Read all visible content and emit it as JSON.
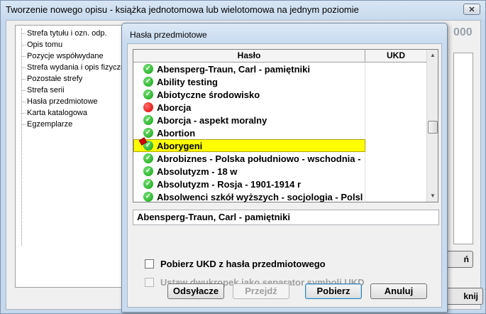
{
  "outer_window": {
    "title": "Tworzenie nowego opisu - książka jednotomowa lub wielotomowa na jednym poziomie",
    "close_glyph": "✕",
    "nav_items": [
      "Strefa tytułu i ozn. odp.",
      "Opis tomu",
      "Pozycje współwydane",
      "Strefa wydania i opis fizyczny",
      "Pozostałe strefy",
      "Strefa serii",
      "Hasła przedmiotowe",
      "Karta katalogowa",
      "Egzemplarze"
    ],
    "background_counter": "000",
    "background_button_1": "ń",
    "background_button_2": "knij"
  },
  "dialog": {
    "title": "Hasła przedmiotowe",
    "grid": {
      "headers": {
        "haslo": "Hasło",
        "ukd": "UKD"
      },
      "rows": [
        {
          "label": "Abensperg-Traun, Carl - pamiętniki",
          "status": "ok",
          "ukd": ""
        },
        {
          "label": "Ability testing",
          "status": "ok",
          "ukd": ""
        },
        {
          "label": "Abiotyczne środowisko",
          "status": "ok",
          "ukd": ""
        },
        {
          "label": "Aborcja",
          "status": "error",
          "ukd": ""
        },
        {
          "label": "Aborcja - aspekt moralny",
          "status": "ok",
          "ukd": ""
        },
        {
          "label": "Abortion",
          "status": "ok",
          "ukd": ""
        },
        {
          "label": "Aborygeni",
          "status": "edit",
          "ukd": "",
          "selected": true
        },
        {
          "label": "Abrobiznes - Polska południowo - wschodnia -",
          "status": "ok",
          "ukd": ""
        },
        {
          "label": "Absolutyzm - 18 w",
          "status": "ok",
          "ukd": ""
        },
        {
          "label": "Absolutyzm - Rosja - 1901-1914 r",
          "status": "ok",
          "ukd": ""
        },
        {
          "label": "Absolwenci szkół wyższych - socjologia - Polsl",
          "status": "ok",
          "ukd": ""
        }
      ],
      "scroll_up_glyph": "▲",
      "scroll_down_glyph": "▼"
    },
    "selected_value": "Abensperg-Traun, Carl - pamiętniki",
    "checkbox_ukd": {
      "label": "Pobierz UKD z hasła przedmiotowego",
      "checked": false,
      "enabled": true
    },
    "checkbox_separator": {
      "label": "Ustaw dwukropek jako separator symboli UKD",
      "checked": false,
      "enabled": false
    },
    "buttons": {
      "odsylacze": "Odsyłacze",
      "przejdz": "Przejdź",
      "pobierz": "Pobierz",
      "anuluj": "Anuluj"
    }
  },
  "colors": {
    "status_ok": "#14a214",
    "status_error": "#d60000",
    "selection": "#ffff00",
    "title_bar": "#c8dbef"
  }
}
